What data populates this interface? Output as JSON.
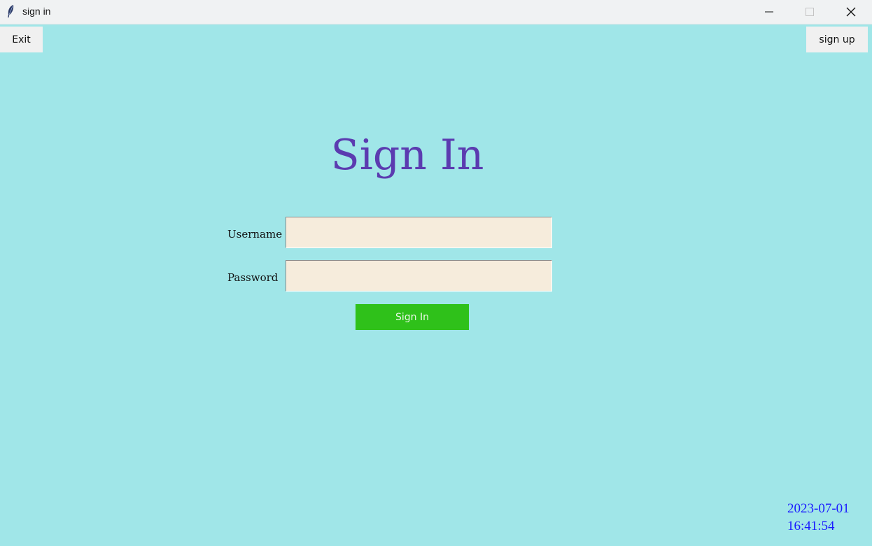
{
  "window": {
    "title": "sign in",
    "icon": "feather-icon",
    "controls": [
      "minimize-icon",
      "maximize-icon",
      "close-icon"
    ]
  },
  "toolbar": {
    "exit_label": "Exit",
    "signup_label": "sign up"
  },
  "form": {
    "heading": "Sign In",
    "username_label": "Username",
    "username_value": "",
    "password_label": "Password",
    "password_value": "",
    "submit_label": "Sign In"
  },
  "clock": {
    "date": "2023-07-01",
    "time": "16:41:54"
  },
  "colors": {
    "background": "#a0e6e8",
    "heading": "#5b3bb0",
    "input_bg": "#f6ecdc",
    "submit_bg": "#2fc11a",
    "clock": "#1b1bff"
  }
}
